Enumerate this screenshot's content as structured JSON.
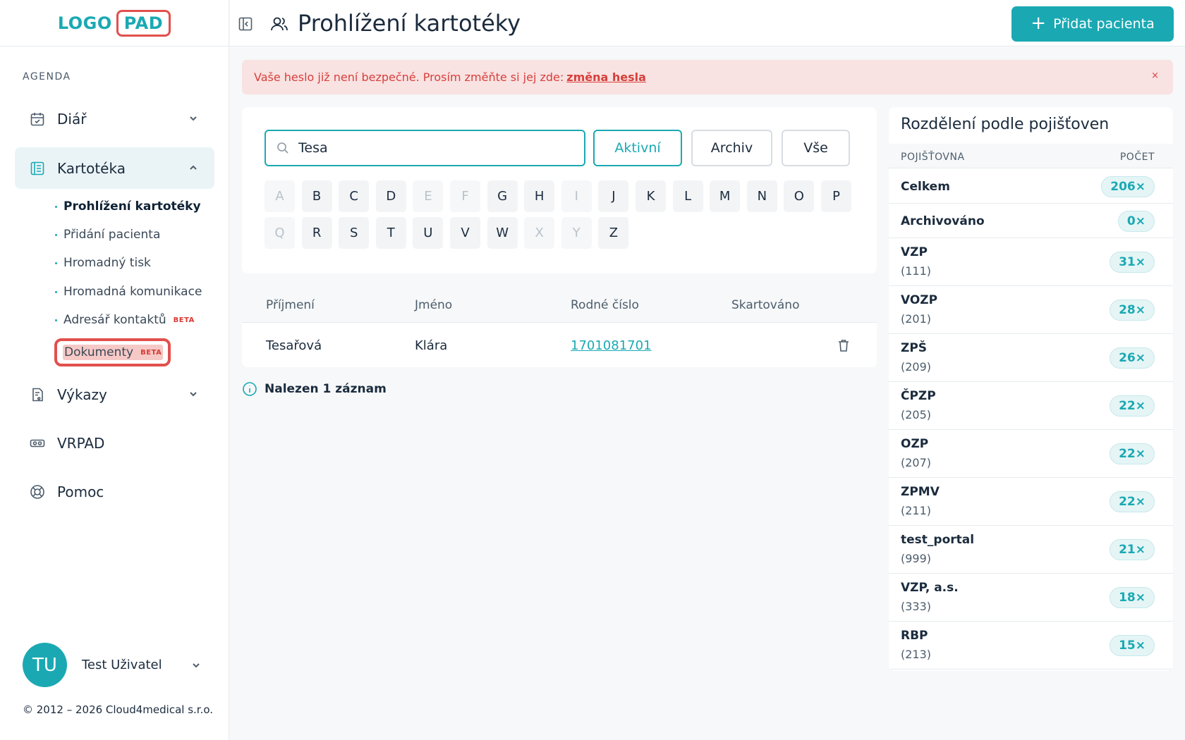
{
  "app": {
    "logo_left": "LOGO",
    "logo_right": "PAD"
  },
  "sidebar": {
    "section_label": "AGENDA",
    "items": [
      {
        "label": "Diář",
        "icon": "calendar-icon"
      },
      {
        "label": "Kartotéka",
        "icon": "card-file-icon"
      },
      {
        "label": "Výkazy",
        "icon": "report-icon"
      },
      {
        "label": "VRPAD",
        "icon": "vr-headset-icon"
      },
      {
        "label": "Pomoc",
        "icon": "lifebuoy-icon"
      }
    ],
    "sub_items": [
      {
        "label": "Prohlížení kartotéky"
      },
      {
        "label": "Přidání pacienta"
      },
      {
        "label": "Hromadný tisk"
      },
      {
        "label": "Hromadná komunikace"
      },
      {
        "label": "Adresář kontaktů",
        "badge": "BETA"
      },
      {
        "label": "Dokumenty",
        "badge": "BETA"
      }
    ],
    "user": {
      "initials": "TU",
      "name": "Test Uživatel"
    },
    "copyright": "© 2012 – 2026 Cloud4medical s.r.o."
  },
  "header": {
    "title": "Prohlížení kartotéky",
    "add_button": "Přidat pacienta"
  },
  "alert": {
    "text": "Vaše heslo již není bezpečné. Prosím změňte si jej zde:",
    "link": "změna hesla",
    "close": "×"
  },
  "search": {
    "value": "Tesa",
    "placeholder": "",
    "filters": [
      "Aktivní",
      "Archiv",
      "Vše"
    ],
    "active_filter": "Aktivní",
    "letters_row1": [
      "A",
      "B",
      "C",
      "D",
      "E",
      "F",
      "G",
      "H",
      "I",
      "J",
      "K",
      "L",
      "M",
      "N",
      "O",
      "P"
    ],
    "letters_row2": [
      "Q",
      "R",
      "S",
      "T",
      "U",
      "V",
      "W",
      "X",
      "Y",
      "Z"
    ],
    "disabled_letters": [
      "A",
      "E",
      "F",
      "I",
      "Q",
      "X",
      "Y"
    ]
  },
  "table": {
    "columns": [
      "Příjmení",
      "Jméno",
      "Rodné číslo",
      "Skartováno"
    ],
    "rows": [
      {
        "surname": "Tesařová",
        "name": "Klára",
        "birth_number": "1701081701",
        "shredded": ""
      }
    ],
    "found_text": "Nalezen 1 záznam"
  },
  "insurers": {
    "title": "Rozdělení podle pojišťoven",
    "col_insurer": "POJIŠŤOVNA",
    "col_count": "POČET",
    "rows": [
      {
        "name": "Celkem",
        "code": "",
        "count": "206×"
      },
      {
        "name": "Archivováno",
        "code": "",
        "count": "0×"
      },
      {
        "name": "VZP",
        "code": "(111)",
        "count": "31×"
      },
      {
        "name": "VOZP",
        "code": "(201)",
        "count": "28×"
      },
      {
        "name": "ZPŠ",
        "code": "(209)",
        "count": "26×"
      },
      {
        "name": "ČPZP",
        "code": "(205)",
        "count": "22×"
      },
      {
        "name": "OZP",
        "code": "(207)",
        "count": "22×"
      },
      {
        "name": "ZPMV",
        "code": "(211)",
        "count": "22×"
      },
      {
        "name": "test_portal",
        "code": "(999)",
        "count": "21×"
      },
      {
        "name": "VZP, a.s.",
        "code": "(333)",
        "count": "18×"
      },
      {
        "name": "RBP",
        "code": "(213)",
        "count": "15×"
      }
    ]
  },
  "colors": {
    "accent": "#1aa9b3",
    "alert_bg": "#f9e2e2",
    "alert_text": "#d7403b",
    "highlight": "#e2504c"
  }
}
